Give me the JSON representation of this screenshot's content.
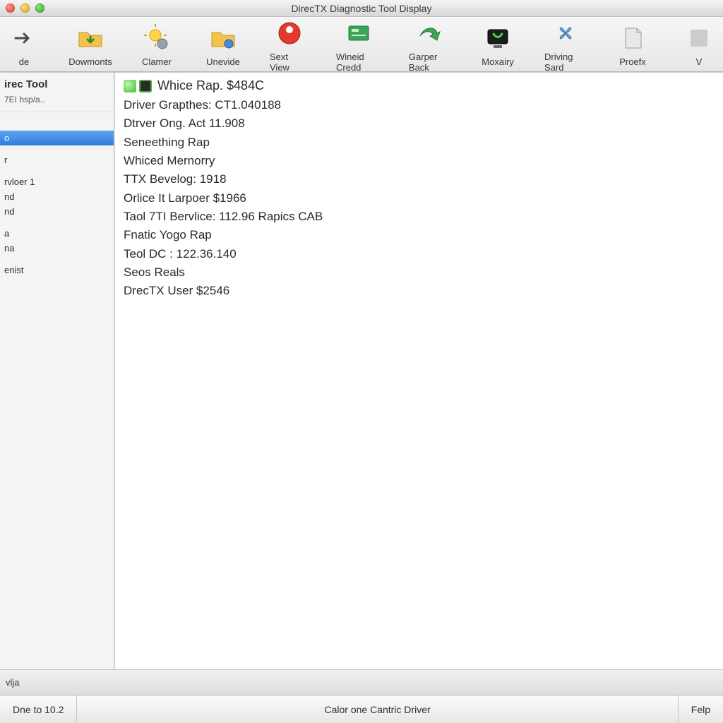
{
  "window": {
    "title": "DirecTX Diagnostic Tool Display"
  },
  "toolbar": [
    {
      "id": "de",
      "label": "de",
      "icon": "arrow-right"
    },
    {
      "id": "dowmonts",
      "label": "Dowmonts",
      "icon": "folder-down"
    },
    {
      "id": "clamer",
      "label": "Clamer",
      "icon": "sun-gear"
    },
    {
      "id": "unevide",
      "label": "Unevide",
      "icon": "folder-gear"
    },
    {
      "id": "sextview",
      "label": "Sext View",
      "icon": "red-pin"
    },
    {
      "id": "wineidcredd",
      "label": "Wineid Credd",
      "icon": "green-card"
    },
    {
      "id": "garperback",
      "label": "Garper Back",
      "icon": "green-arrow"
    },
    {
      "id": "moxairy",
      "label": "Moxairy",
      "icon": "display-green"
    },
    {
      "id": "drivingsard",
      "label": "Driving Sard",
      "icon": "fan-blue"
    },
    {
      "id": "proefx",
      "label": "Proefx",
      "icon": "page-gray"
    },
    {
      "id": "v",
      "label": "V",
      "icon": "cut"
    }
  ],
  "sidebar": {
    "title": "irec Tool",
    "subtitle": "7EI hsp/a..",
    "items": [
      {
        "label": "",
        "kind": "spacer"
      },
      {
        "label": "",
        "kind": "spacer"
      },
      {
        "label": "o",
        "selected": true
      },
      {
        "label": "",
        "kind": "spacer"
      },
      {
        "label": "r"
      },
      {
        "label": "",
        "kind": "spacer"
      },
      {
        "label": "rvloer 1"
      },
      {
        "label": "nd"
      },
      {
        "label": "nd"
      },
      {
        "label": "",
        "kind": "spacer"
      },
      {
        "label": "a"
      },
      {
        "label": "na"
      },
      {
        "label": "",
        "kind": "spacer"
      },
      {
        "label": "enist"
      }
    ]
  },
  "content": {
    "title": "Whice Rap. $484C",
    "lines": [
      "Driver Grapthes: CT1.040188",
      "Dtrver Ong. Act 11.908",
      "Seneething Rap",
      "Whiced Mernorry",
      "TTX Bevelog: 1918",
      "Orlice It Larpoer $1966",
      "Taol 7TI Bervlice: 112.96 Rapics CAB",
      "Fnatic Yogo Rap",
      "Teol DC : 122.36.140",
      "Seos Reals",
      "DrecTX User $2546"
    ]
  },
  "status": {
    "left": "vlja"
  },
  "bottom": {
    "left": "Dne to 10.2",
    "center": "Calor one Cantric Driver",
    "right": "Felp"
  }
}
